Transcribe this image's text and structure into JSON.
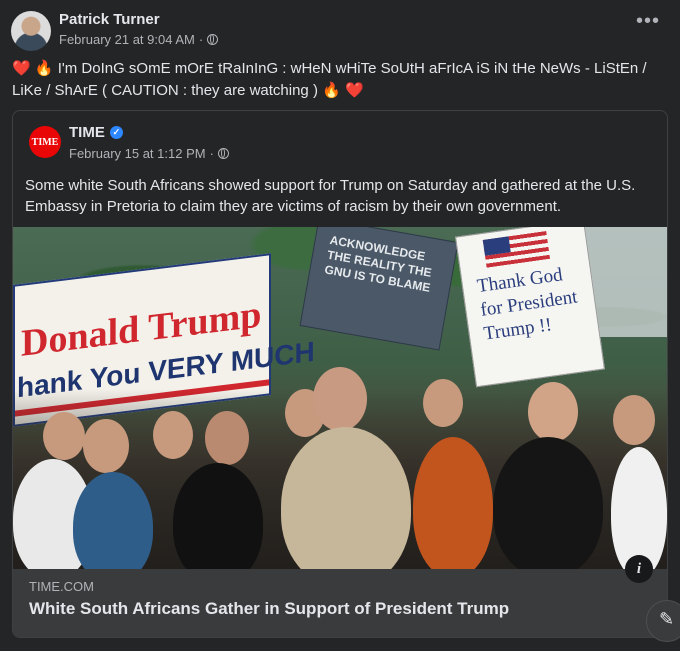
{
  "post": {
    "author": "Patrick Turner",
    "timestamp": "February 21 at 9:04 AM",
    "separator": "·",
    "more_label": "•••",
    "message_pre": "I'm DoInG sOmE mOrE tRaInInG : wHeN wHiTe SoUtH aFrIcA iS iN tHe NeWs - LiStEn / LiKe / ShArE ( CAUTION : they are watching )",
    "emoji_heart": "❤️",
    "emoji_fire": "🔥"
  },
  "shared": {
    "page_name": "TIME",
    "logo_text": "TIME",
    "timestamp": "February 15 at 1:12 PM",
    "separator": "·",
    "body": "Some white South Africans showed support for Trump on Saturday and gathered at the U.S. Embassy in Pretoria to claim they are victims of racism by their own government.",
    "photo": {
      "banner_line1": "Donald Trump",
      "banner_line2": "hank You VERY MUCH",
      "sign_left": "ACKNOWLEDGE THE REALITY THE GNU IS TO BLAME",
      "sign_right": "Thank God for President Trump !!"
    },
    "link": {
      "domain": "TIME.COM",
      "headline": "White South Africans Gather in Support of President Trump",
      "info_label": "i"
    }
  },
  "colors": {
    "background": "#242526",
    "text": "#e4e6eb",
    "muted": "#b0b3b8",
    "verified": "#2d88ff",
    "time_red": "#e90606"
  }
}
